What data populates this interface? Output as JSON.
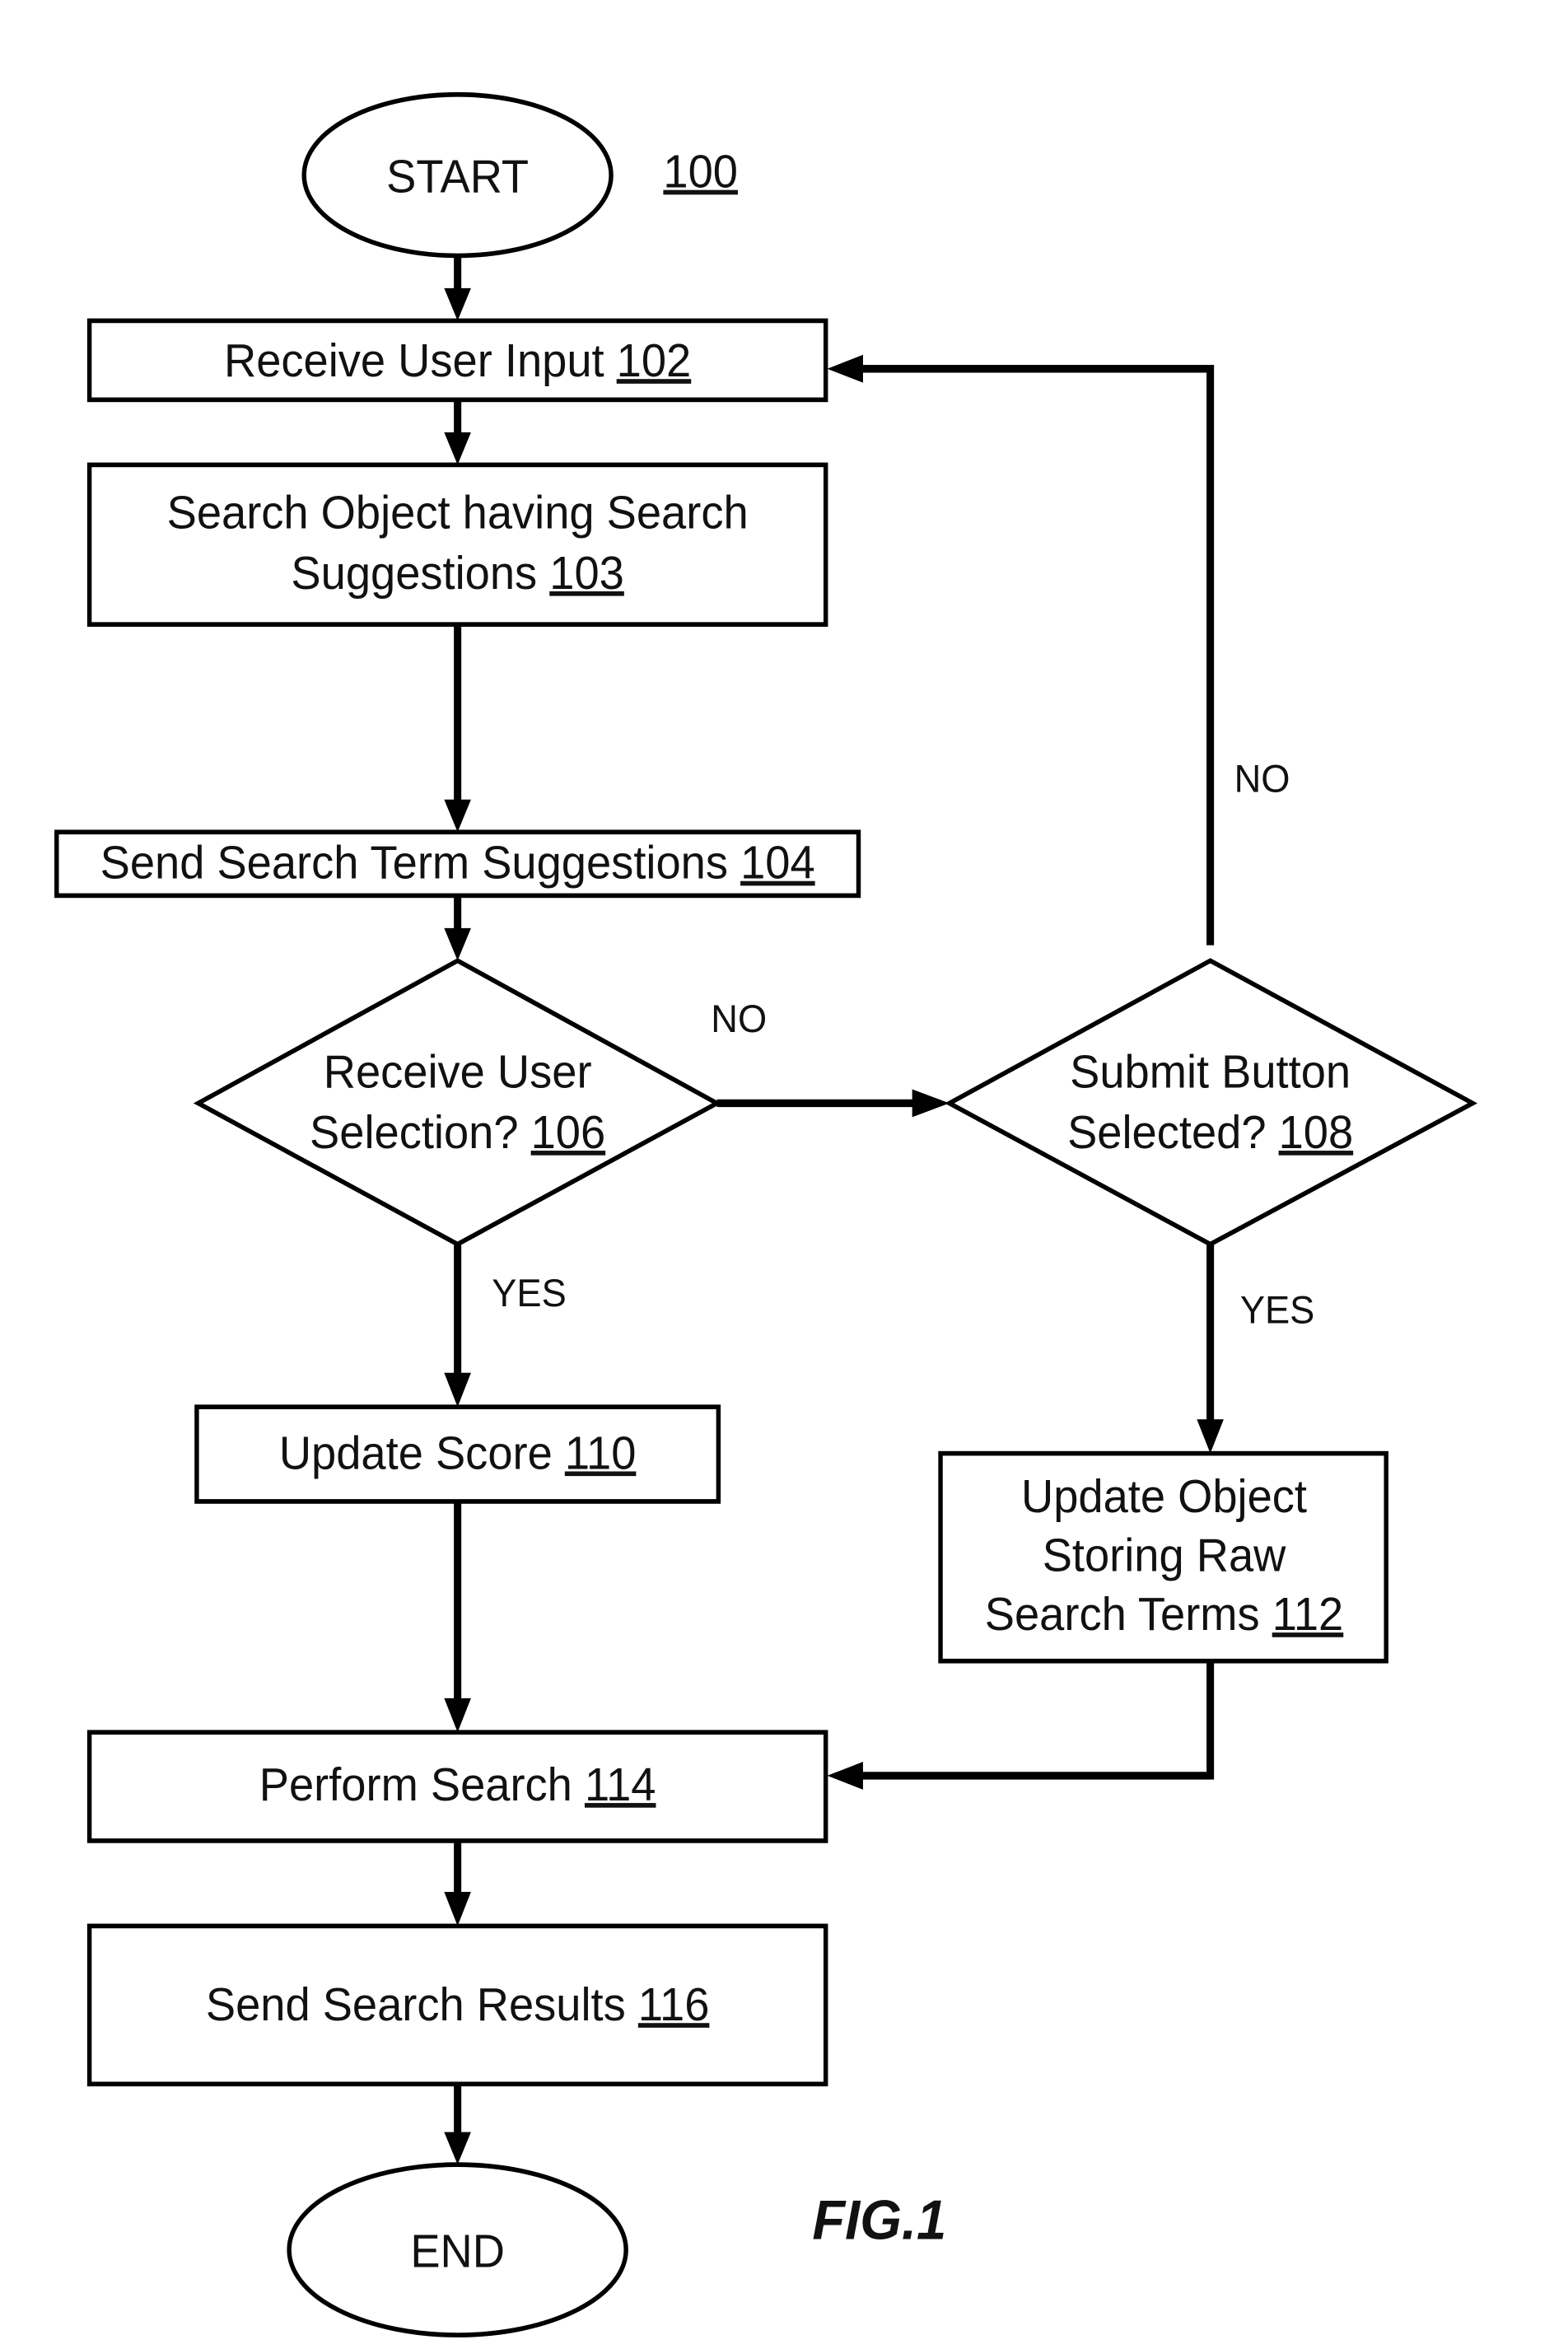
{
  "diagram": {
    "ref": "100",
    "figure_label": "FIG.1",
    "nodes": {
      "start": {
        "text": "START"
      },
      "n102": {
        "text": "Receive User Input ",
        "ref": "102"
      },
      "n103": {
        "line1": "Search Object having Search",
        "line2": "Suggestions ",
        "ref": "103"
      },
      "n104": {
        "text": "Send Search Term Suggestions ",
        "ref": "104"
      },
      "n106": {
        "line1": "Receive User",
        "line2": "Selection? ",
        "ref": "106"
      },
      "n108": {
        "line1": "Submit Button",
        "line2": "Selected? ",
        "ref": "108"
      },
      "n110": {
        "text": "Update Score ",
        "ref": "110"
      },
      "n112": {
        "line1": "Update Object",
        "line2": "Storing Raw",
        "line3": "Search Terms ",
        "ref": "112"
      },
      "n114": {
        "text": "Perform Search ",
        "ref": "114"
      },
      "n116": {
        "text": "Send Search Results ",
        "ref": "116"
      },
      "end": {
        "text": "END"
      }
    },
    "edge_labels": {
      "n106_no": "NO",
      "n106_yes": "YES",
      "n108_no": "NO",
      "n108_yes": "YES"
    }
  }
}
